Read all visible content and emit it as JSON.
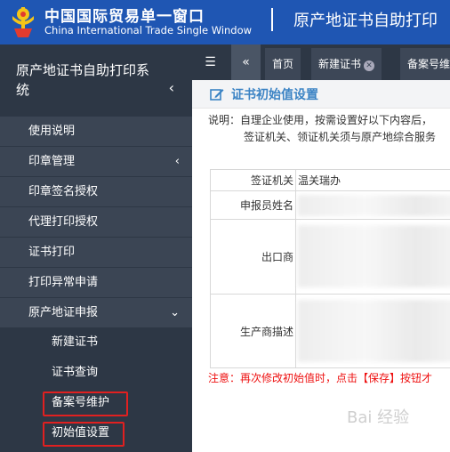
{
  "header": {
    "brand_cn": "中国国际贸易单一窗口",
    "brand_en": "China International Trade Single Window",
    "module_title": "原产地证书自助打印"
  },
  "sidebar": {
    "title": "原产地证书自助打印系统",
    "items": [
      {
        "label": "使用说明"
      },
      {
        "label": "印章管理"
      },
      {
        "label": "印章签名授权"
      },
      {
        "label": "代理打印授权"
      },
      {
        "label": "证书打印"
      },
      {
        "label": "打印异常申请"
      },
      {
        "label": "原产地证申报"
      }
    ],
    "subitems": [
      {
        "label": "新建证书"
      },
      {
        "label": "证书查询"
      },
      {
        "label": "备案号维护"
      },
      {
        "label": "初始值设置"
      }
    ]
  },
  "tabs": [
    {
      "label": "首页"
    },
    {
      "label": "新建证书"
    },
    {
      "label": "备案号维"
    }
  ],
  "main": {
    "page_title": "证书初始值设置",
    "note_line1": "说明：自理企业使用，按需设置好以下内容后，",
    "note_line2": "签证机关、领证机关须与原产地综合服务",
    "fields": [
      {
        "label": "签证机关",
        "value": "温关瑞办"
      },
      {
        "label": "申报员姓名",
        "value": ""
      },
      {
        "label": "出口商",
        "value": ""
      },
      {
        "label": "生产商描述",
        "value": ""
      }
    ],
    "warning": "注意：再次修改初始值时，点击【保存】按钮才"
  },
  "watermark": "Bai 经验",
  "colors": {
    "header_bg": "#1f56b3",
    "sidebar_bg": "#2d3745",
    "accent_title": "#3b83c4",
    "highlight_border": "#e02020",
    "warning_text": "#e11111"
  }
}
